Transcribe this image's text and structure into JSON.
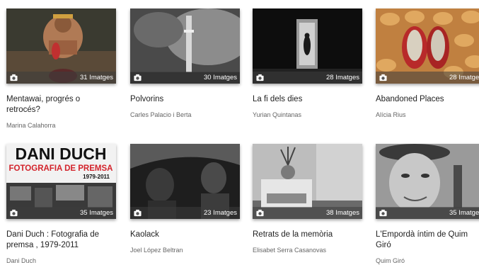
{
  "albums": [
    {
      "title": "Mentawai, progrés o retrocés?",
      "author": "Marina Calahorra",
      "count": "31 Imatges"
    },
    {
      "title": "Polvorins",
      "author": "Carles Palacio i Berta",
      "count": "30 Imatges"
    },
    {
      "title": "La fi dels dies",
      "author": "Yurian Quintanas",
      "count": "28 Imatges"
    },
    {
      "title": "Abandoned Places",
      "author": "Alícia Rius",
      "count": "28 Imatges"
    },
    {
      "title": "Dani Duch : Fotografia de premsa , 1979-2011",
      "author": "Dani Duch",
      "count": "35 Imatges",
      "cover": {
        "line1": "DANI DUCH",
        "line2": "FOTOGRAFIA DE PREMSA",
        "line3": "1979-2011"
      }
    },
    {
      "title": "Kaolack",
      "author": "Joel López Beltran",
      "count": "23 Imatges"
    },
    {
      "title": "Retrats de la memòria",
      "author": "Elisabet Serra Casanovas",
      "count": "38 Imatges"
    },
    {
      "title": "L'Empordà íntim de Quim Giró",
      "author": "Quim Giró",
      "count": "35 Imatges"
    }
  ],
  "icons": {
    "camera": "camera-icon"
  },
  "colors": {
    "overlay": "#3c3c3c",
    "title": "#222222",
    "author": "#666666",
    "cover_red": "#d3232b"
  }
}
